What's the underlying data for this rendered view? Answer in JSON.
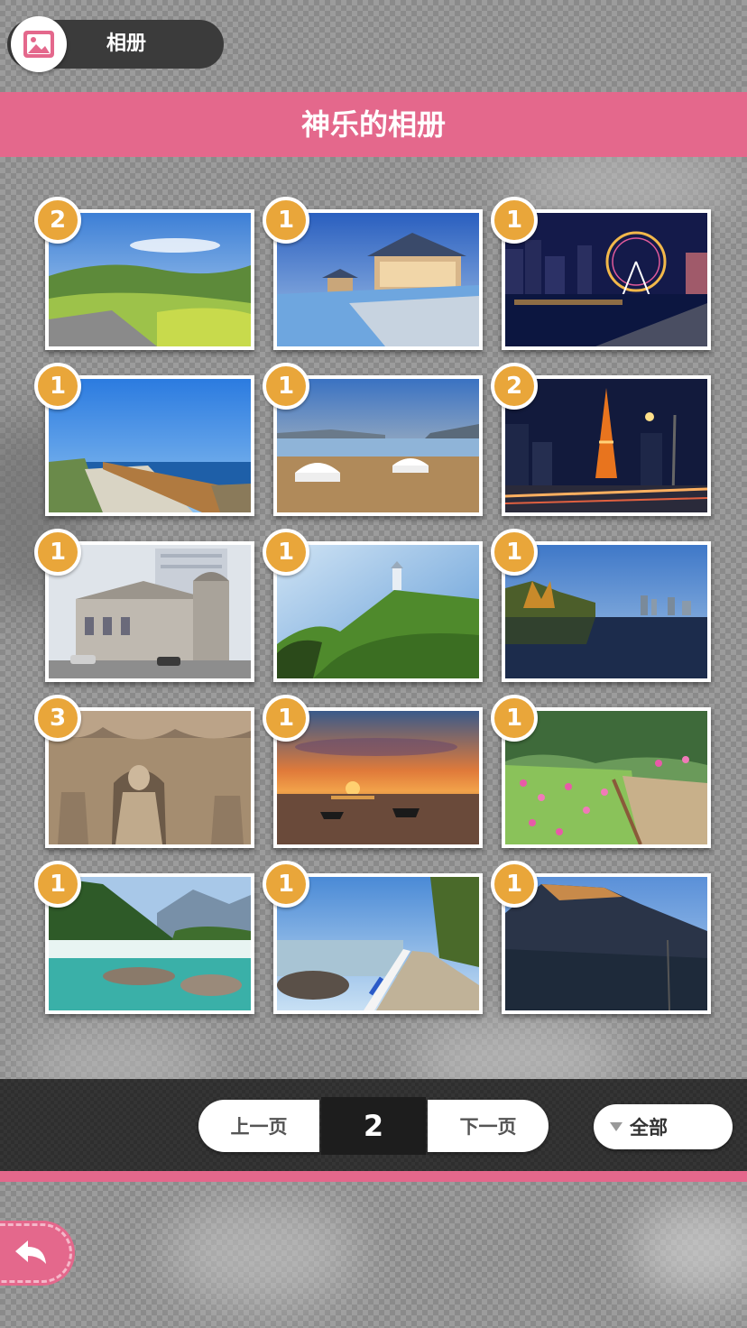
{
  "header": {
    "title": "相册",
    "icon": "album-icon"
  },
  "banner": {
    "title": "神乐的相册"
  },
  "gallery": {
    "tiles": [
      {
        "name": "photo-meadow",
        "count": "2"
      },
      {
        "name": "photo-pool-pavilion",
        "count": "1"
      },
      {
        "name": "photo-ferris-wheel-night",
        "count": "1"
      },
      {
        "name": "photo-coastal-walkway",
        "count": "1"
      },
      {
        "name": "photo-yurts-lake",
        "count": "1"
      },
      {
        "name": "photo-tower-night",
        "count": "2"
      },
      {
        "name": "photo-old-building",
        "count": "1"
      },
      {
        "name": "photo-hill-lighthouse",
        "count": "1"
      },
      {
        "name": "photo-lake-reflection",
        "count": "1"
      },
      {
        "name": "photo-grotto-buddha",
        "count": "3"
      },
      {
        "name": "photo-sunset-boats",
        "count": "1"
      },
      {
        "name": "photo-flower-path",
        "count": "1"
      },
      {
        "name": "photo-waterfall-river",
        "count": "1"
      },
      {
        "name": "photo-seaside-road",
        "count": "1"
      },
      {
        "name": "photo-mountain-cliff",
        "count": "1"
      }
    ]
  },
  "pager": {
    "prev_label": "上一页",
    "page": "2",
    "next_label": "下一页",
    "filter_label": "全部"
  },
  "colors": {
    "accent_pink": "#e4688c",
    "badge_orange": "#e9a63a"
  },
  "back": {
    "icon": "back-arrow-icon"
  }
}
